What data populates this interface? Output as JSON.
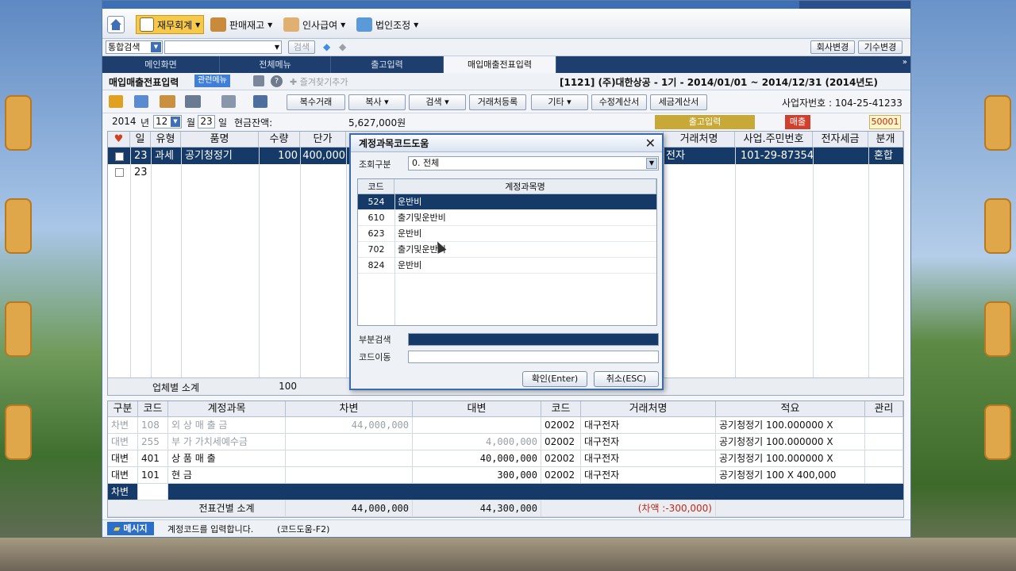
{
  "toolbar": {
    "finance": "재무회계",
    "sales": "판매재고",
    "hr": "인사급여",
    "corp": "법인조정"
  },
  "search": {
    "select_value": "통합검색",
    "button": "검색",
    "company_change": "회사변경",
    "period_change": "기수변경"
  },
  "tabs": [
    "메인화면",
    "전체메뉴",
    "출고입력",
    "매입매출전표입력"
  ],
  "header": {
    "title": "매입매출전표입력",
    "menu": "관련메뉴",
    "company_info": "[1121] (주)대한상공 - 1기 - 2014/01/01 ~ 2014/12/31 (2014년도)",
    "bookmark": "즐겨찾기추가"
  },
  "buttons": {
    "multi": "복수거래",
    "copy": "복사",
    "search": "검색",
    "partner": "거래처등록",
    "etc": "기타",
    "amend": "수정계산서",
    "tax_invoice": "세금계산서",
    "business_no": "사업자번호 : 104-25-41233"
  },
  "date": {
    "year": "2014",
    "year_label": "년",
    "month": "12",
    "month_label": "월",
    "day": "23",
    "day_label": "일",
    "cash_label": "현금잔액:",
    "cash": "5,627,000원",
    "out_btn": "출고입력",
    "sales_badge": "매출",
    "code": "50001"
  },
  "grid": {
    "headers": [
      "일",
      "유형",
      "품명",
      "수량",
      "단가",
      "거래처명",
      "사업.주민번호",
      "전자세금",
      "분개"
    ],
    "row1": {
      "day": "23",
      "type": "과세",
      "item": "공기청정기",
      "qty": "100",
      "price": "400,000",
      "partner": "전자",
      "bizno": "101-29-87354",
      "journal": "혼합"
    },
    "row2": {
      "day": "23"
    },
    "subtotal_label": "업체별 소계",
    "subtotal_qty": "100"
  },
  "lower": {
    "headers": [
      "구분",
      "코드",
      "계정과목",
      "차변",
      "대변",
      "코드",
      "거래처명",
      "적요",
      "관리"
    ],
    "rows": [
      {
        "div": "차변",
        "code": "108",
        "account": "외 상 매 출 금",
        "debit": "44,000,000",
        "credit": "",
        "pcode": "02002",
        "partner": "대구전자",
        "memo": "공기청정기 100.000000 X",
        "grey": true
      },
      {
        "div": "대변",
        "code": "255",
        "account": "부 가 가치세예수금",
        "debit": "",
        "credit": "4,000,000",
        "pcode": "02002",
        "partner": "대구전자",
        "memo": "공기청정기 100.000000 X",
        "grey": true
      },
      {
        "div": "대변",
        "code": "401",
        "account": "상   품   매   출",
        "debit": "",
        "credit": "40,000,000",
        "pcode": "02002",
        "partner": "대구전자",
        "memo": "공기청정기 100.000000 X",
        "grey": false
      },
      {
        "div": "대변",
        "code": "101",
        "account": "현                금",
        "debit": "",
        "credit": "300,000",
        "pcode": "02002",
        "partner": "대구전자",
        "memo": "공기청정기 100 X 400,000",
        "grey": false
      }
    ],
    "edit_row_div": "차변",
    "total_label": "전표건별 소계",
    "total_debit": "44,000,000",
    "total_credit": "44,300,000",
    "diff": "(차액 :-300,000)"
  },
  "status": {
    "label": "메시지",
    "text": "계정코드를 입력합니다.",
    "help": "(코드도움-F2)"
  },
  "dialog": {
    "title": "계정과목코드도움",
    "filter_label": "조회구분",
    "filter_value": "0. 전체",
    "col_code": "코드",
    "col_name": "계정과목명",
    "items": [
      {
        "code": "524",
        "name": "운반비"
      },
      {
        "code": "610",
        "name": "출기및운반비"
      },
      {
        "code": "623",
        "name": "운반비"
      },
      {
        "code": "702",
        "name": "출기및운반비"
      },
      {
        "code": "824",
        "name": "운반비"
      }
    ],
    "partial_label": "부분검색",
    "goto_label": "코드이동",
    "ok": "확인(Enter)",
    "cancel": "취소(ESC)"
  }
}
